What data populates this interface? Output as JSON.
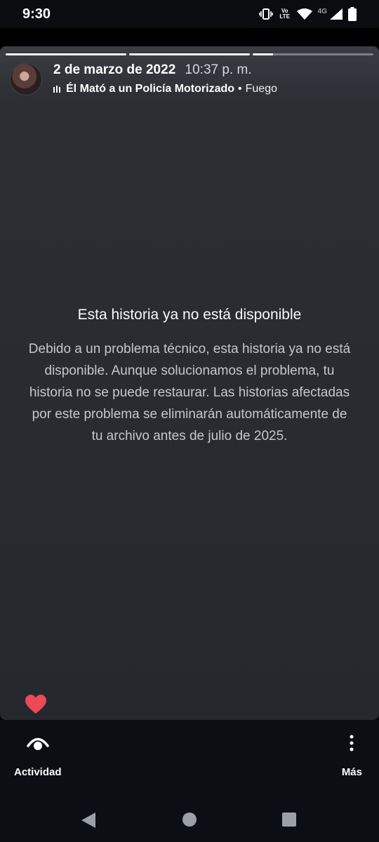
{
  "status_bar": {
    "time": "9:30",
    "volte_label": "Vo LTE",
    "network_label": "4G",
    "icons": [
      "vibrate-icon",
      "volte-icon",
      "wifi-icon",
      "signal-icon",
      "battery-icon"
    ]
  },
  "story": {
    "progress_segments": [
      1.0,
      1.0,
      0.17
    ],
    "date": "2 de marzo de 2022",
    "time": "10:37 p. m.",
    "song": "Él Mató a un Policía Motorizado",
    "separator": "•",
    "artist": "Fuego",
    "unavailable_title": "Esta historia ya no está disponible",
    "unavailable_body": "Debido a un problema técnico, esta historia ya no está disponible. Aunque solucionamos el problema, tu historia no se puede restaurar. Las historias afectadas por este problema se eliminarán automáticamente de tu archivo antes de julio de 2025."
  },
  "bottom_actions": {
    "activity_label": "Actividad",
    "more_label": "Más"
  },
  "colors": {
    "heart": "#ed4956",
    "story_bg": "#2b2e33",
    "bar_bg": "#0b0e13"
  }
}
